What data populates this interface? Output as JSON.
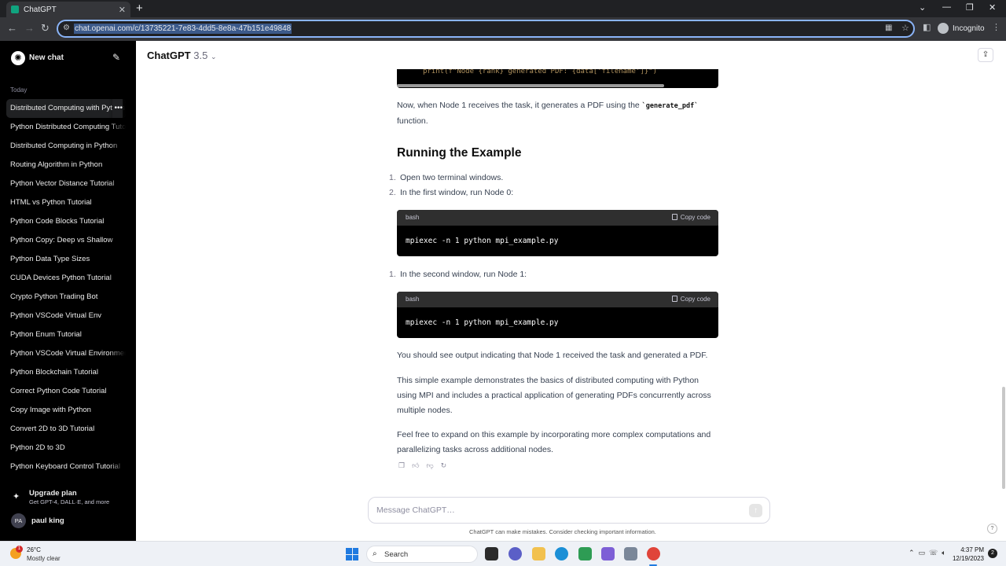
{
  "browser": {
    "tab_title": "ChatGPT",
    "tab_close": "✕",
    "new_tab": "+",
    "url": "chat.openai.com/c/13735221-7e83-4dd5-8e8a-47b151e49848",
    "profile_label": "Incognito",
    "window_controls": [
      "⌄",
      "—",
      "❐",
      "✕"
    ]
  },
  "sidebar": {
    "new_chat_label": "New chat",
    "section_today": "Today",
    "history": [
      "Distributed Computing with Python",
      "Python Distributed Computing Tutorial",
      "Distributed Computing in Python",
      "Routing Algorithm in Python",
      "Python Vector Distance Tutorial",
      "HTML vs Python Tutorial",
      "Python Code Blocks Tutorial",
      "Python Copy: Deep vs Shallow",
      "Python Data Type Sizes",
      "CUDA Devices Python Tutorial",
      "Crypto Python Trading Bot",
      "Python VSCode Virtual Env",
      "Python Enum Tutorial",
      "Python VSCode Virtual Environment",
      "Python Blockchain Tutorial",
      "Correct Python Code Tutorial",
      "Copy Image with Python",
      "Convert 2D to 3D Tutorial",
      "Python 2D to 3D",
      "Python Keyboard Control Tutorial"
    ],
    "history_more": "•••",
    "upgrade_title": "Upgrade plan",
    "upgrade_subtitle": "Get GPT-4, DALL·E, and more",
    "user_initials": "PA",
    "user_name": "paul king"
  },
  "main": {
    "model_name": "ChatGPT",
    "model_version": "3.5",
    "code_partial_line": "print(f\"Node {rank} generated PDF: {data['filename']}\")",
    "para1_pre": "Now, when Node 1 receives the task, it generates a PDF using the ",
    "para1_code": "`generate_pdf`",
    "para1_post": " function.",
    "heading": "Running the Example",
    "list1": [
      {
        "num": "1.",
        "text": "Open two terminal windows."
      },
      {
        "num": "2.",
        "text": "In the first window, run Node 0:"
      }
    ],
    "code1": {
      "lang": "bash",
      "copy": "Copy code",
      "code": "mpiexec -n 1 python mpi_example.py"
    },
    "list2": [
      {
        "num": "1.",
        "text": "In the second window, run Node 1:"
      }
    ],
    "code2": {
      "lang": "bash",
      "copy": "Copy code",
      "code": "mpiexec -n 1 python mpi_example.py"
    },
    "para2": "You should see output indicating that Node 1 received the task and generated a PDF.",
    "para3": "This simple example demonstrates the basics of distributed computing with Python using MPI and includes a practical application of generating PDFs concurrently across multiple nodes.",
    "para4": "Feel free to expand on this example by incorporating more complex computations and parallelizing tasks across additional nodes.",
    "composer_placeholder": "Message ChatGPT…",
    "disclaimer": "ChatGPT can make mistakes. Consider checking important information.",
    "help": "?"
  },
  "taskbar": {
    "weather_temp": "26°C",
    "weather_condition": "Mostly clear",
    "weather_badge": "1",
    "search_label": "Search",
    "time": "4:37 PM",
    "date": "12/19/2023",
    "notification_badge": "2"
  },
  "colors": {
    "sidebar_bg": "#000000",
    "omnibox_border": "#8ab4f8",
    "code_bg": "#000000",
    "start_blue": "#1f7ae0"
  }
}
